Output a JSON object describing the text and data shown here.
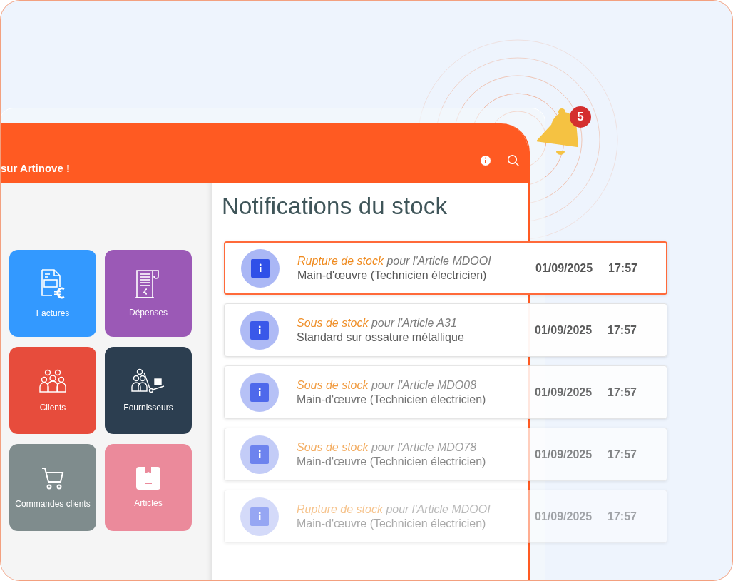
{
  "header": {
    "title": "sur Artinove !"
  },
  "bell": {
    "badge": "5"
  },
  "panel": {
    "title": "Notifications du stock"
  },
  "tiles": [
    {
      "label": "Factures",
      "kind": "invoice",
      "color": "#3399ff"
    },
    {
      "label": "Dépenses",
      "kind": "receipt",
      "color": "#9b59b6"
    },
    {
      "label": "Clients",
      "kind": "people",
      "color": "#e74c3c"
    },
    {
      "label": "Fournisseurs",
      "kind": "supplier",
      "color": "#2c3e50"
    },
    {
      "label": "Commandes clients",
      "kind": "cart",
      "color": "#7f8c8d"
    },
    {
      "label": "Articles",
      "kind": "box",
      "color": "#eb8a9b"
    }
  ],
  "notifications": [
    {
      "alert": "Rupture de stock",
      "subject": "pour l'Article MDOOI",
      "detail": "Main-d'œuvre (Technicien électricien)",
      "date": "01/09/2025",
      "time": "17:57",
      "selected": true
    },
    {
      "alert": "Sous de stock",
      "subject": "pour l'Article A31",
      "detail": "Standard sur ossature métallique",
      "date": "01/09/2025",
      "time": "17:57",
      "selected": false
    },
    {
      "alert": "Sous de stock",
      "subject": "pour l'Article MDO08",
      "detail": "Main-d'œuvre (Technicien électricien)",
      "date": "01/09/2025",
      "time": "17:57",
      "selected": false
    },
    {
      "alert": "Sous de stock",
      "subject": "pour l'Article MDO78",
      "detail": "Main-d'œuvre (Technicien électricien)",
      "date": "01/09/2025",
      "time": "17:57",
      "selected": false
    },
    {
      "alert": "Rupture de stock",
      "subject": "pour l'Article MDOOI",
      "detail": "Main-d'œuvre (Technicien électricien)",
      "date": "01/09/2025",
      "time": "17:57",
      "selected": false
    }
  ]
}
